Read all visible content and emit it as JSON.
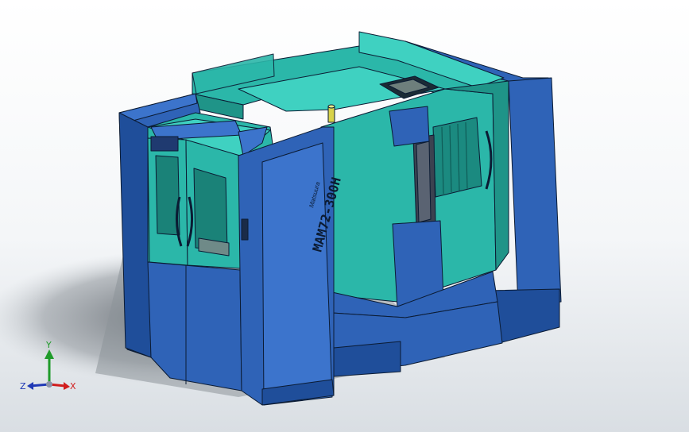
{
  "model": {
    "model_label": "MAM72-300H",
    "brand_mark": "Matsuura",
    "colors": {
      "shell_blue": "#2f63b7",
      "shell_blue_dark": "#1f4e9a",
      "shell_blue_light": "#3c74cc",
      "machine_teal": "#2bb7a9",
      "machine_teal_light": "#3fd1c1",
      "machine_teal_dark": "#1f9488",
      "window_dark": "#0f5c57",
      "edge": "#0b1b33",
      "pin_yellow": "#d8d24a",
      "shadow": "#6b7178"
    }
  },
  "triad": {
    "y_label": "Y",
    "x_label": "X",
    "z_label": "Z",
    "colors": {
      "x": "#d11d1d",
      "y": "#1f9b2a",
      "z": "#2039b5"
    }
  }
}
